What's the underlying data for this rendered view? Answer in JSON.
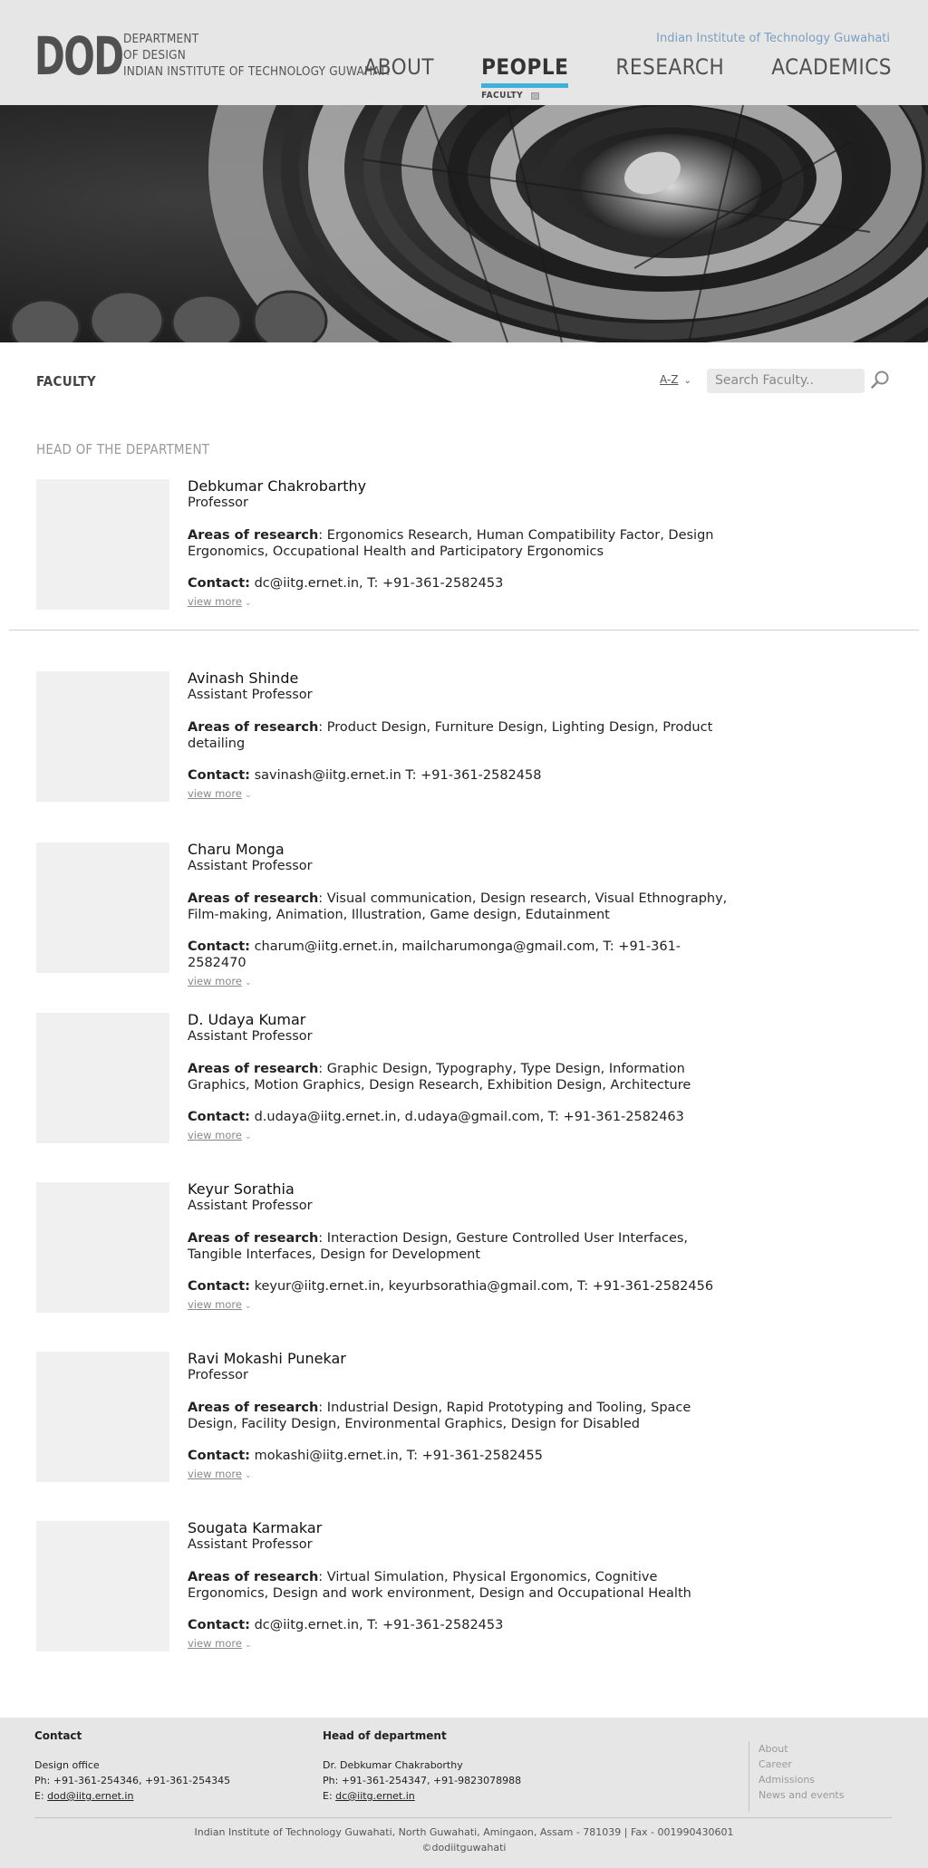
{
  "header": {
    "logo_mark": "DOD",
    "logo_lines": [
      "DEPARTMENT",
      "OF DESIGN",
      "INDIAN INSTITUTE OF TECHNOLOGY GUWAHATI"
    ],
    "iit_link": "Indian Institute of Technology Guwahati",
    "nav": [
      {
        "label": "ABOUT",
        "active": false
      },
      {
        "label": "PEOPLE",
        "active": true,
        "sub": "FACULTY"
      },
      {
        "label": "RESEARCH",
        "active": false
      },
      {
        "label": "ACADEMICS",
        "active": false
      }
    ]
  },
  "filter": {
    "section_title": "FACULTY",
    "sort_label": "A-Z",
    "search_placeholder": "Search Faculty.."
  },
  "group_label": "HEAD OF THE DEPARTMENT",
  "research_label": "Areas of research",
  "contact_label": "Contact:",
  "view_more": "view more",
  "faculty": [
    {
      "name": "Debkumar Chakrobarthy",
      "role": "Professor",
      "research": ": Ergonomics Research, Human Compatibility Factor, Design Ergonomics,  Occupational Health and Participatory Ergonomics",
      "contact": " dc@iitg.ernet.in, T: +91-361-2582453"
    },
    {
      "name": "Avinash Shinde",
      "role": "Assistant Professor",
      "research": ": Product Design, Furniture Design, Lighting Design, Product detailing",
      "contact": " savinash@iitg.ernet.in T: +91-361-2582458"
    },
    {
      "name": "Charu Monga",
      "role": "Assistant Professor",
      "research": ": Visual communication, Design research, Visual Ethnography, Film-making, Animation, Illustration, Game design, Edutainment",
      "contact": " charum@iitg.ernet.in, mailcharumonga@gmail.com, T: +91-361-2582470"
    },
    {
      "name": "D. Udaya Kumar",
      "role": "Assistant Professor",
      "research": ": Graphic Design, Typography, Type Design, Information Graphics, Motion Graphics, Design Research, Exhibition Design, Architecture",
      "contact": " d.udaya@iitg.ernet.in, d.udaya@gmail.com, T: +91-361-2582463"
    },
    {
      "name": "Keyur Sorathia",
      "role": "Assistant Professor",
      "research": ": Interaction Design, Gesture Controlled User Interfaces, Tangible Interfaces, Design for Development",
      "contact": " keyur@iitg.ernet.in, keyurbsorathia@gmail.com, T: +91-361-2582456"
    },
    {
      "name": "Ravi Mokashi Punekar",
      "role": "Professor",
      "research": ": Industrial Design, Rapid Prototyping and Tooling, Space Design, Facility Design, Environmental Graphics, Design for Disabled",
      "contact": " mokashi@iitg.ernet.in, T: +91-361-2582455"
    },
    {
      "name": "Sougata Karmakar",
      "role": "Assistant Professor",
      "research": ": Virtual Simulation, Physical Ergonomics, Cognitive Ergonomics, Design and work environment, Design and Occupational Health",
      "contact": " dc@iitg.ernet.in, T: +91-361-2582453"
    }
  ],
  "footer": {
    "contact": {
      "heading": "Contact",
      "line1": "Design office",
      "line2": "Ph: +91-361-254346, +91-361-254345",
      "email_prefix": "E: ",
      "email": "dod@iitg.ernet.in"
    },
    "hod": {
      "heading": "Head of department",
      "line1": "Dr. Debkumar Chakraborthy",
      "line2": "Ph: +91-361-254347, +91-9823078988",
      "email_prefix": "E: ",
      "email": "dc@iitg.ernet.in"
    },
    "links": [
      "About",
      "Career",
      "Admissions",
      "News and events"
    ],
    "address": "Indian Institute of Technology Guwahati, North Guwahati, Amingaon, Assam - 781039 | Fax - 001990430601",
    "copyright": "©dodiitguwahati"
  }
}
